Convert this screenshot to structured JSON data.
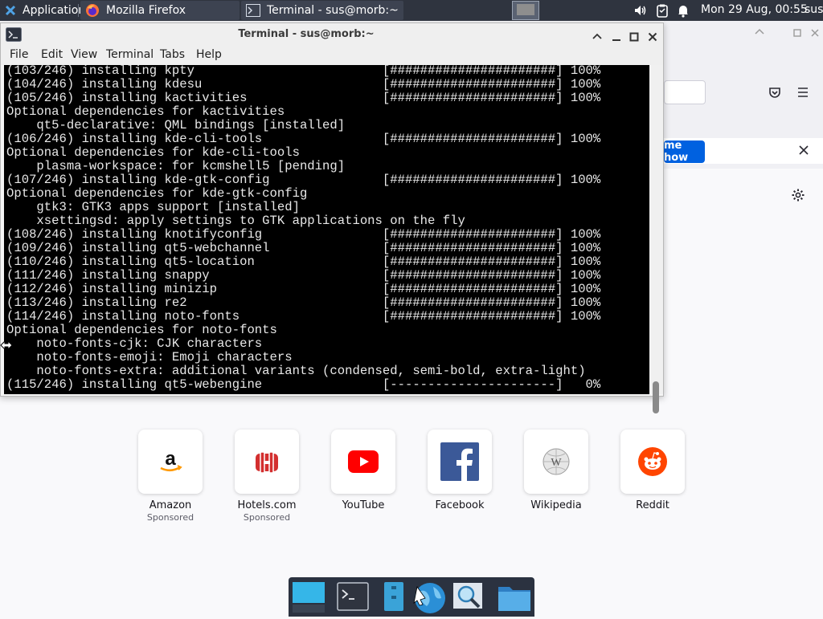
{
  "panel": {
    "applications_label": "Applications",
    "tasks": [
      {
        "label": "Mozilla Firefox"
      },
      {
        "label": "Terminal - sus@morb:~"
      }
    ],
    "clock": "Mon 29 Aug, 00:55",
    "user": "sus"
  },
  "terminal": {
    "title": "Terminal - sus@morb:~",
    "menu": [
      "File",
      "Edit",
      "View",
      "Terminal",
      "Tabs",
      "Help"
    ],
    "lines": [
      "(103/246) installing kpty                         [######################] 100%",
      "(104/246) installing kdesu                        [######################] 100%",
      "(105/246) installing kactivities                  [######################] 100%",
      "Optional dependencies for kactivities",
      "    qt5-declarative: QML bindings [installed]",
      "(106/246) installing kde-cli-tools                [######################] 100%",
      "Optional dependencies for kde-cli-tools",
      "    plasma-workspace: for kcmshell5 [pending]",
      "(107/246) installing kde-gtk-config               [######################] 100%",
      "Optional dependencies for kde-gtk-config",
      "    gtk3: GTK3 apps support [installed]",
      "    xsettingsd: apply settings to GTK applications on the fly",
      "(108/246) installing knotifyconfig                [######################] 100%",
      "(109/246) installing qt5-webchannel               [######################] 100%",
      "(110/246) installing qt5-location                 [######################] 100%",
      "(111/246) installing snappy                       [######################] 100%",
      "(112/246) installing minizip                      [######################] 100%",
      "(113/246) installing re2                          [######################] 100%",
      "(114/246) installing noto-fonts                   [######################] 100%",
      "Optional dependencies for noto-fonts",
      "    noto-fonts-cjk: CJK characters",
      "    noto-fonts-emoji: Emoji characters",
      "    noto-fonts-extra: additional variants (condensed, semi-bold, extra-light)",
      "(115/246) installing qt5-webengine                [----------------------]   0%"
    ]
  },
  "firefox": {
    "notice_button": "me how",
    "shortcuts": [
      {
        "name": "Amazon",
        "sub": "Sponsored",
        "icon": "amazon-icon"
      },
      {
        "name": "Hotels.com",
        "sub": "Sponsored",
        "icon": "hotels-icon"
      },
      {
        "name": "YouTube",
        "sub": "",
        "icon": "youtube-icon"
      },
      {
        "name": "Facebook",
        "sub": "",
        "icon": "facebook-icon"
      },
      {
        "name": "Wikipedia",
        "sub": "",
        "icon": "wikipedia-icon"
      },
      {
        "name": "Reddit",
        "sub": "",
        "icon": "reddit-icon"
      }
    ]
  },
  "dock": {
    "items": [
      "show-desktop-icon",
      "terminal-icon",
      "file-manager-icon",
      "web-browser-icon",
      "app-finder-icon",
      "folder-icon"
    ]
  },
  "colors": {
    "panel_bg": "#2f343f",
    "terminal_bg": "#000000",
    "accent_blue": "#0061e0"
  }
}
